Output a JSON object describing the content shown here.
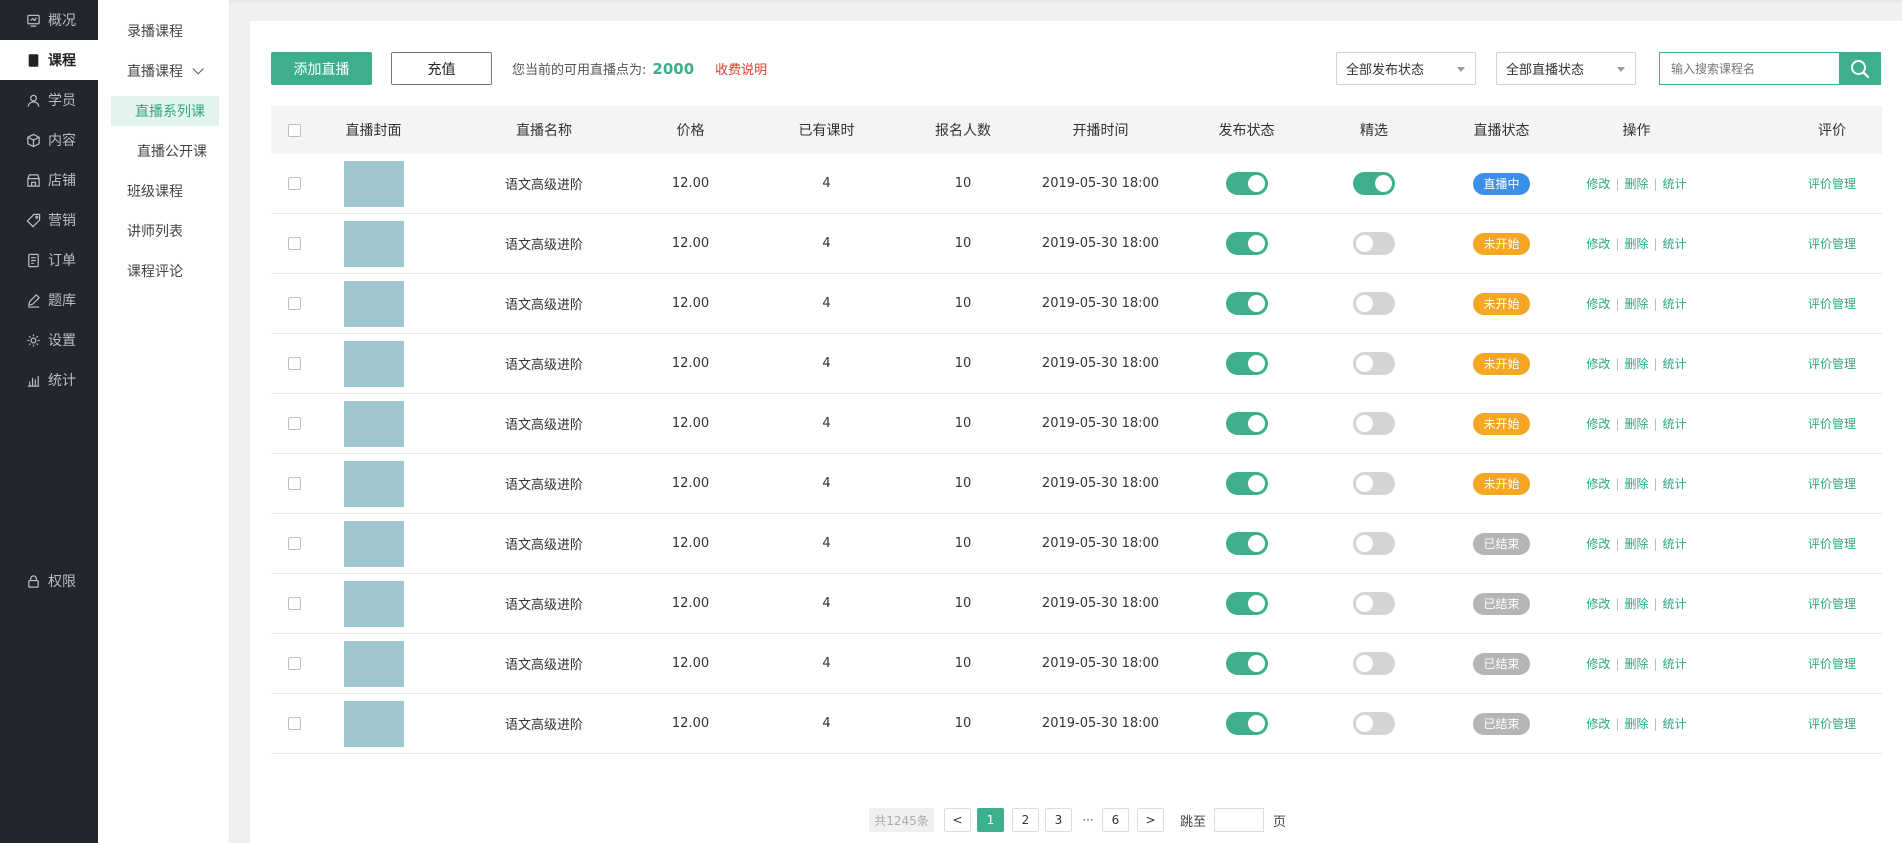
{
  "nav": {
    "items": [
      {
        "label": "概况",
        "icon": "overview-icon",
        "active": false
      },
      {
        "label": "课程",
        "icon": "book-icon",
        "active": true
      },
      {
        "label": "学员",
        "icon": "user-icon",
        "active": false
      },
      {
        "label": "内容",
        "icon": "box-icon",
        "active": false
      },
      {
        "label": "店铺",
        "icon": "store-icon",
        "active": false
      },
      {
        "label": "营销",
        "icon": "tag-icon",
        "active": false
      },
      {
        "label": "订单",
        "icon": "order-icon",
        "active": false
      },
      {
        "label": "题库",
        "icon": "pen-icon",
        "active": false
      },
      {
        "label": "设置",
        "icon": "gear-icon",
        "active": false
      },
      {
        "label": "统计",
        "icon": "bar-chart-icon",
        "active": false
      }
    ],
    "permission": {
      "label": "权限",
      "icon": "lock-icon"
    }
  },
  "subnav": {
    "recorded": "录播课程",
    "live": "直播课程",
    "live_series": "直播系列课",
    "live_public": "直播公开课",
    "class_course": "班级课程",
    "teacher_list": "讲师列表",
    "course_comment": "课程评论"
  },
  "toolbar": {
    "add_live": "添加直播",
    "recharge": "充值",
    "points_text": "您当前的可用直播点为:",
    "points_value": "2000",
    "fee_note": "收费说明",
    "publish_filter": "全部发布状态",
    "live_filter": "全部直播状态",
    "search_placeholder": "输入搜索课程名"
  },
  "table": {
    "headers": [
      "直播封面",
      "直播名称",
      "价格",
      "已有课时",
      "报名人数",
      "开播时间",
      "发布状态",
      "精选",
      "直播状态",
      "操作",
      "评价"
    ],
    "rows": [
      {
        "name": "语文高级进阶",
        "price": "12.00",
        "lessons": "4",
        "signups": "10",
        "time": "2019-05-30 18:00",
        "published": true,
        "featured": true,
        "status": "直播中",
        "status_color": "#3b8fe8"
      },
      {
        "name": "语文高级进阶",
        "price": "12.00",
        "lessons": "4",
        "signups": "10",
        "time": "2019-05-30 18:00",
        "published": true,
        "featured": false,
        "status": "未开始",
        "status_color": "#f5a623"
      },
      {
        "name": "语文高级进阶",
        "price": "12.00",
        "lessons": "4",
        "signups": "10",
        "time": "2019-05-30 18:00",
        "published": true,
        "featured": false,
        "status": "未开始",
        "status_color": "#f5a623"
      },
      {
        "name": "语文高级进阶",
        "price": "12.00",
        "lessons": "4",
        "signups": "10",
        "time": "2019-05-30 18:00",
        "published": true,
        "featured": false,
        "status": "未开始",
        "status_color": "#f5a623"
      },
      {
        "name": "语文高级进阶",
        "price": "12.00",
        "lessons": "4",
        "signups": "10",
        "time": "2019-05-30 18:00",
        "published": true,
        "featured": false,
        "status": "未开始",
        "status_color": "#f5a623"
      },
      {
        "name": "语文高级进阶",
        "price": "12.00",
        "lessons": "4",
        "signups": "10",
        "time": "2019-05-30 18:00",
        "published": true,
        "featured": false,
        "status": "未开始",
        "status_color": "#f5a623"
      },
      {
        "name": "语文高级进阶",
        "price": "12.00",
        "lessons": "4",
        "signups": "10",
        "time": "2019-05-30 18:00",
        "published": true,
        "featured": false,
        "status": "已结束",
        "status_color": "#b5b5b5"
      },
      {
        "name": "语文高级进阶",
        "price": "12.00",
        "lessons": "4",
        "signups": "10",
        "time": "2019-05-30 18:00",
        "published": true,
        "featured": false,
        "status": "已结束",
        "status_color": "#b5b5b5"
      },
      {
        "name": "语文高级进阶",
        "price": "12.00",
        "lessons": "4",
        "signups": "10",
        "time": "2019-05-30 18:00",
        "published": true,
        "featured": false,
        "status": "已结束",
        "status_color": "#b5b5b5"
      },
      {
        "name": "语文高级进阶",
        "price": "12.00",
        "lessons": "4",
        "signups": "10",
        "time": "2019-05-30 18:00",
        "published": true,
        "featured": false,
        "status": "已结束",
        "status_color": "#b5b5b5"
      }
    ],
    "ops": {
      "edit": "修改",
      "delete": "删除",
      "stats": "统计",
      "sep": "|"
    },
    "review": "评价管理"
  },
  "pager": {
    "total": "共1245条",
    "prev": "<",
    "pages": [
      "1",
      "2",
      "3"
    ],
    "dots": "···",
    "last": "6",
    "next": ">",
    "jump_label": "跳至",
    "page_unit": "页",
    "current": "1"
  },
  "colors": {
    "accent": "#3daf8c",
    "nav_bg": "#21272c",
    "danger": "#e63a2e"
  }
}
